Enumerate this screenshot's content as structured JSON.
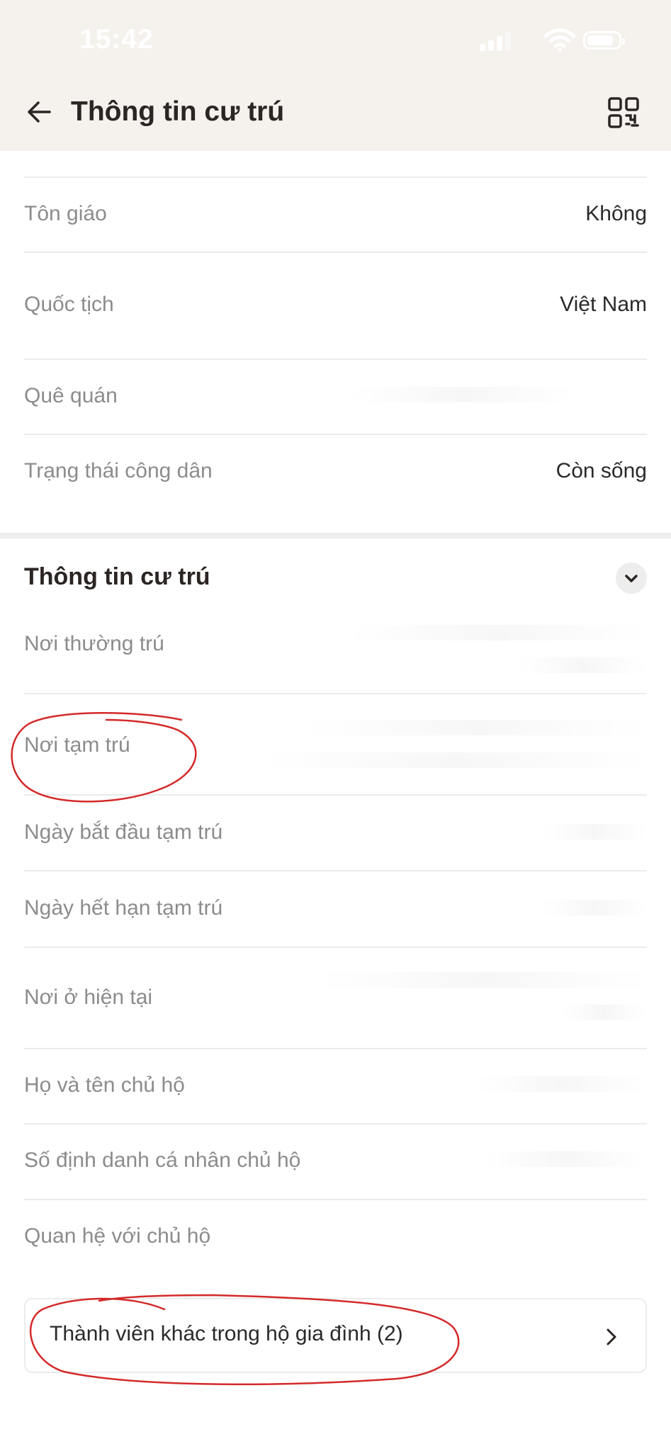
{
  "status_bar": {
    "time": "15:42"
  },
  "header": {
    "title": "Thông tin cư trú"
  },
  "personal_rows": [
    {
      "label": "Tôn giáo",
      "value": "Không"
    },
    {
      "label": "Quốc tịch",
      "value": "Việt Nam"
    },
    {
      "label": "Quê quán",
      "value": ""
    },
    {
      "label": "Trạng thái công dân",
      "value": "Còn sống"
    }
  ],
  "residence_section": {
    "title": "Thông tin cư trú",
    "rows": [
      {
        "label": "Nơi thường trú"
      },
      {
        "label": "Nơi tạm trú"
      },
      {
        "label": "Ngày bắt đầu tạm trú"
      },
      {
        "label": "Ngày hết hạn tạm trú"
      },
      {
        "label": "Nơi ở hiện tại"
      },
      {
        "label": "Họ và tên chủ hộ"
      },
      {
        "label": "Số định danh cá nhân chủ hộ"
      },
      {
        "label": "Quan hệ với chủ hộ"
      }
    ]
  },
  "household_members": {
    "label": "Thành viên khác trong hộ gia đình (2)"
  },
  "colors": {
    "header_bg": "#f5f1ed",
    "annotation_red": "#d42a2a"
  },
  "icons": {
    "back": "arrow-left-icon",
    "qr": "qr-code-icon",
    "collapse": "chevron-down-icon",
    "members": "chevron-right-icon"
  }
}
